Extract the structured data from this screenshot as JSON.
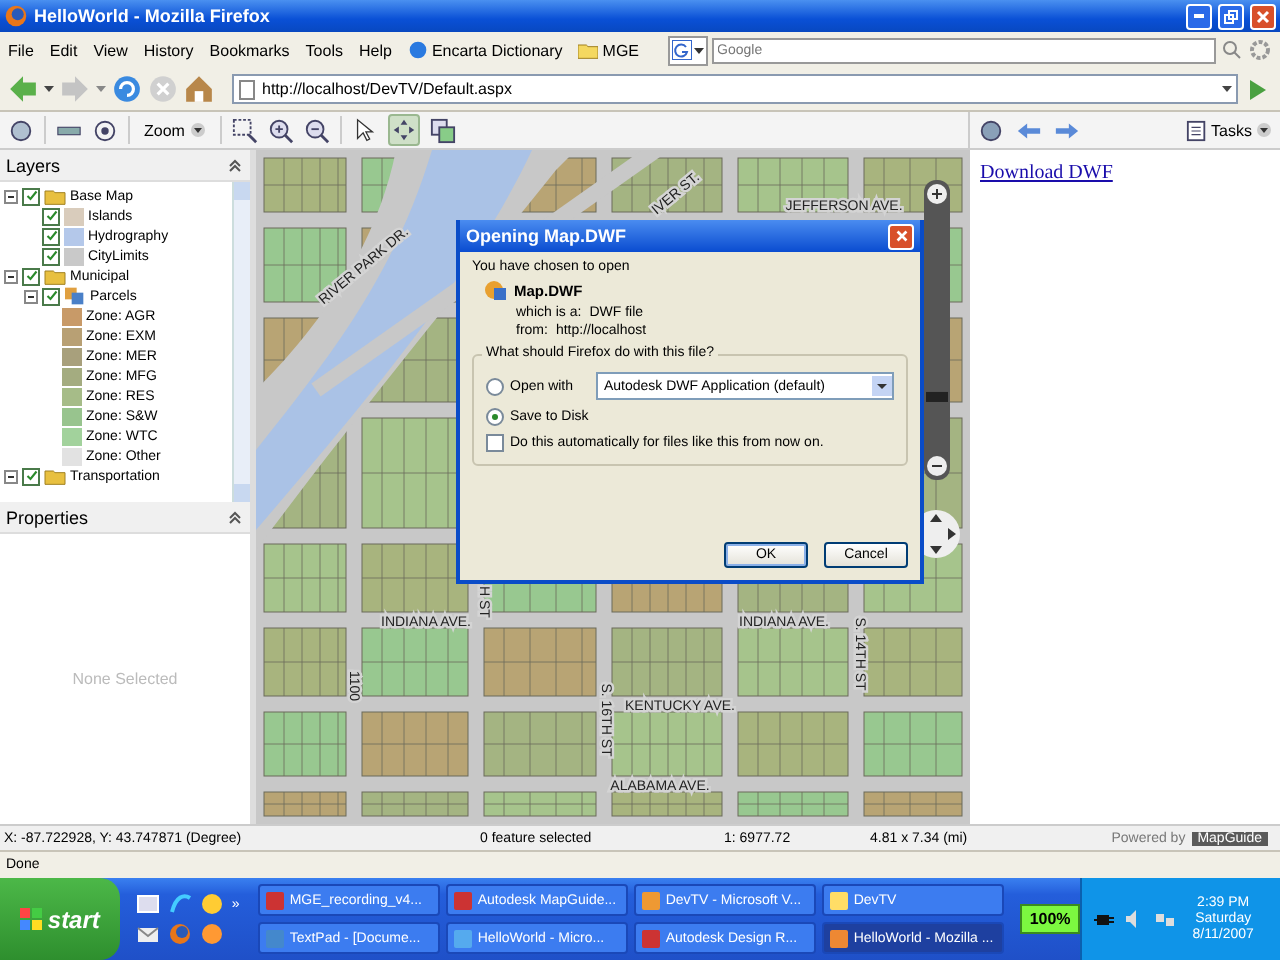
{
  "window": {
    "title": "HelloWorld - Mozilla Firefox"
  },
  "menu": [
    "File",
    "Edit",
    "View",
    "History",
    "Bookmarks",
    "Tools",
    "Help"
  ],
  "bookmarks": [
    {
      "label": "Encarta Dictionary",
      "kind": "link"
    },
    {
      "label": "MGE",
      "kind": "folder"
    }
  ],
  "search": {
    "placeholder": "Google"
  },
  "address": {
    "value": "http://localhost/DevTV/Default.aspx"
  },
  "map_toolbar": {
    "zoom_label": "Zoom"
  },
  "task_toolbar": {
    "label": "Tasks"
  },
  "layers": {
    "title": "Layers",
    "items": [
      {
        "label": "Base Map",
        "kind": "group",
        "checked": true,
        "expanded": true,
        "children": [
          {
            "label": "Islands",
            "kind": "layer",
            "checked": true,
            "color": "#d9ccbc"
          },
          {
            "label": "Hydrography",
            "kind": "layer",
            "checked": true,
            "color": "#b4c8ea"
          },
          {
            "label": "CityLimits",
            "kind": "layer",
            "checked": true,
            "color": "#c9c9c9"
          }
        ]
      },
      {
        "label": "Municipal",
        "kind": "group",
        "checked": true,
        "expanded": true,
        "children": [
          {
            "label": "Parcels",
            "kind": "themed",
            "checked": true,
            "expanded": true,
            "children": [
              {
                "label": "Zone: AGR",
                "kind": "theme",
                "color": "#c89a68"
              },
              {
                "label": "Zone: EXM",
                "kind": "theme",
                "color": "#b8a074"
              },
              {
                "label": "Zone: MER",
                "kind": "theme",
                "color": "#a8a07c"
              },
              {
                "label": "Zone: MFG",
                "kind": "theme",
                "color": "#a4ac80"
              },
              {
                "label": "Zone: RES",
                "kind": "theme",
                "color": "#a6bc88"
              },
              {
                "label": "Zone: S&W",
                "kind": "theme",
                "color": "#98c48e"
              },
              {
                "label": "Zone: WTC",
                "kind": "theme",
                "color": "#a2d29c"
              },
              {
                "label": "Zone: Other",
                "kind": "theme",
                "color": "#e2e2e2"
              }
            ]
          }
        ]
      },
      {
        "label": "Transportation",
        "kind": "group",
        "checked": true,
        "expanded": true
      }
    ]
  },
  "properties": {
    "title": "Properties",
    "empty": "None Selected"
  },
  "map": {
    "zoom_slider": {
      "level": 0.27
    },
    "street_labels": [
      "RIVER PARK DR.",
      "IVER ST.",
      "JEFFERSON AVE.",
      "INDIANA AVE.",
      "INDIANA AVE.",
      "S. 14TH ST",
      "KENTUCKY AVE.",
      "S. 16TH ST",
      "ALABAMA AVE.",
      "1100",
      "H ST"
    ]
  },
  "dialog": {
    "title": "Opening Map.DWF",
    "intro": "You have chosen to open",
    "file_name": "Map.DWF",
    "type_label": "which is a:",
    "type_value": "DWF file",
    "from_label": "from:",
    "from_value": "http://localhost",
    "legend": "What should Firefox do with this file?",
    "options": [
      {
        "label": "Open with",
        "selected": false
      },
      {
        "label": "Save to Disk",
        "selected": true
      }
    ],
    "app": "Autodesk DWF Application (default)",
    "auto": {
      "label": "Do this automatically for files like this from now on.",
      "checked": false
    },
    "buttons": [
      "OK",
      "Cancel"
    ]
  },
  "task_pane": {
    "link": "Download DWF"
  },
  "status": {
    "coords": "X: -87.722928, Y: 43.747871 (Degree)",
    "selection": "0 feature selected",
    "scale": "1: 6977.72",
    "size": "4.81 x 7.34 (mi)",
    "powered_by": "Powered by",
    "brand": "MapGuide"
  },
  "browser_status": "Done",
  "taskbar": {
    "start": "start",
    "quick_launch_more": "»",
    "tasks": [
      {
        "label": "MGE_recording_v4...",
        "selected": false
      },
      {
        "label": "Autodesk MapGuide...",
        "selected": false
      },
      {
        "label": "DevTV - Microsoft V...",
        "selected": false
      },
      {
        "label": "DevTV",
        "selected": false
      },
      {
        "label": "TextPad - [Docume...",
        "selected": false
      },
      {
        "label": "HelloWorld - Micro...",
        "selected": false
      },
      {
        "label": "Autodesk Design R...",
        "selected": false
      },
      {
        "label": "HelloWorld - Mozilla ...",
        "selected": true
      }
    ],
    "battery": "100%",
    "clock": {
      "time": "2:39 PM",
      "day": "Saturday",
      "date": "8/11/2007"
    }
  }
}
